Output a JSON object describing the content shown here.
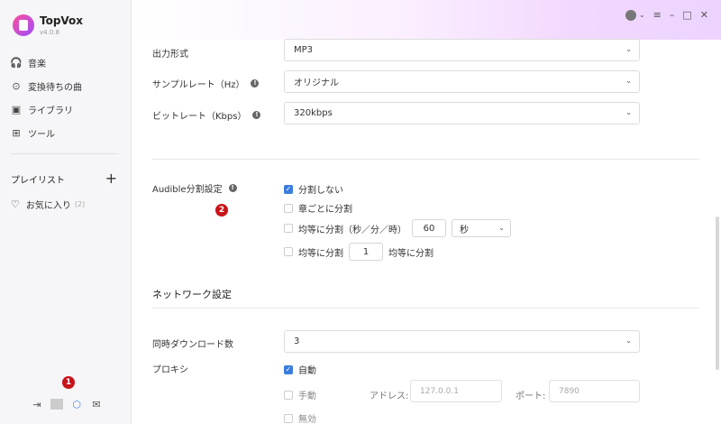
{
  "app": {
    "name": "TopVox",
    "version": "v4.0.8"
  },
  "sidebar": {
    "items": [
      {
        "label": "音楽",
        "icon": "headphones-icon"
      },
      {
        "label": "変換待ちの曲",
        "icon": "download-circle-icon"
      },
      {
        "label": "ライブラリ",
        "icon": "library-icon"
      },
      {
        "label": "ツール",
        "icon": "grid-icon"
      }
    ],
    "playlist_title": "プレイリスト",
    "playlist_add": "+",
    "favorites": {
      "label": "お気に入り",
      "count": "(2)"
    }
  },
  "markers": {
    "one": "1",
    "two": "2"
  },
  "settings": {
    "output_format": {
      "label": "出力形式",
      "value": "MP3"
    },
    "sample_rate": {
      "label": "サンプルレート（Hz）",
      "value": "オリジナル"
    },
    "bitrate": {
      "label": "ビットレート（Kbps）",
      "value": "320kbps"
    },
    "audible_split": {
      "label": "Audible分割設定",
      "options": {
        "no_split": "分割しない",
        "by_chapter": "章ごとに分割",
        "by_time_prefix": "均等に分割（秒／分／時）",
        "time_value": "60",
        "time_unit": "秒",
        "by_count_prefix": "均等に分割",
        "count_value": "1",
        "by_count_suffix": "均等に分割"
      }
    },
    "network_title": "ネットワーク設定",
    "concurrent": {
      "label": "同時ダウンロード数",
      "value": "3"
    },
    "proxy": {
      "label": "プロキシ",
      "auto": "自動",
      "manual": "手動",
      "address_label": "アドレス:",
      "address_placeholder": "127.0.0.1",
      "port_label": "ポート:",
      "port_placeholder": "7890",
      "disabled": "無効"
    }
  },
  "colors": {
    "accent": "#3b7ddd",
    "marker": "#c8131b"
  }
}
